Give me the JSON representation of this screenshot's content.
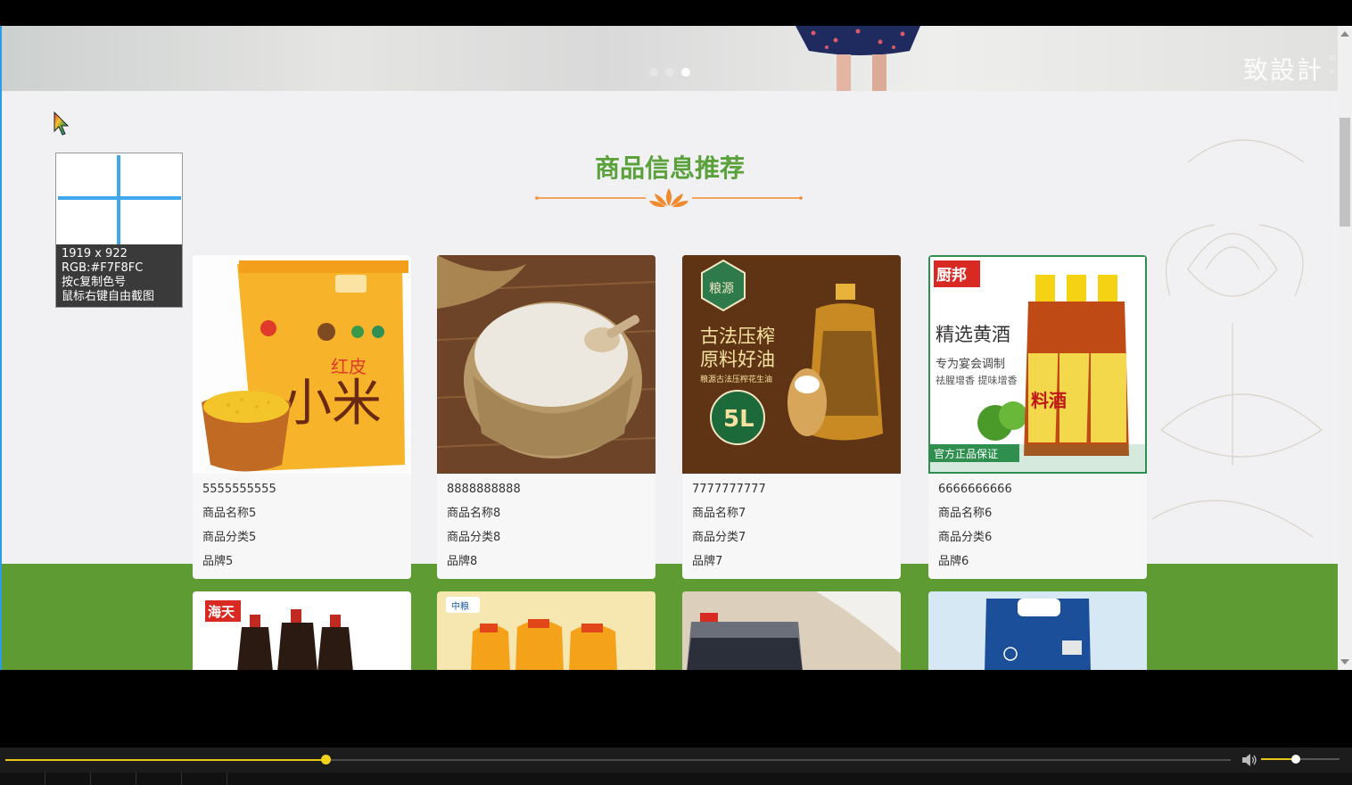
{
  "section": {
    "title": "商品信息推荐"
  },
  "banner": {
    "watermark": "致設計",
    "watermark_small": "申\nw",
    "slide_count": 3,
    "active_slide": 3
  },
  "picker": {
    "size": "1919 x 922",
    "color": "RGB:#F7F8FC",
    "hint1": "按c复制色号",
    "hint2": "鼠标右键自由截图"
  },
  "products": [
    {
      "code": "5555555555",
      "name": "商品名称5",
      "category": "商品分类5",
      "brand": "品牌5",
      "image": {
        "brand_text": "红皮",
        "main_text": "小米"
      }
    },
    {
      "code": "8888888888",
      "name": "商品名称8",
      "category": "商品分类8",
      "brand": "品牌8",
      "image": {}
    },
    {
      "code": "7777777777",
      "name": "商品名称7",
      "category": "商品分类7",
      "brand": "品牌7",
      "image": {
        "logo": "粮源",
        "headline1": "古法压榨",
        "headline2": "原料好油",
        "sub": "粮源古法压榨花生油",
        "badge": "5L"
      }
    },
    {
      "code": "6666666666",
      "name": "商品名称6",
      "category": "商品分类6",
      "brand": "品牌6",
      "image": {
        "logo": "厨邦",
        "headline": "精选黄酒",
        "sub1": "专为宴会调制",
        "sub2": "祛腥增香 提味增香",
        "label": "料酒",
        "badge": "官方正品保证"
      }
    }
  ],
  "products_row2": [
    {
      "image": {
        "logo": "海天"
      }
    },
    {
      "image": {
        "logo": "中粮"
      }
    },
    {
      "image": {}
    },
    {
      "image": {}
    }
  ],
  "player": {
    "progress": 0.261,
    "volume": 0.44
  },
  "colors": {
    "accent_green": "#5aa13c",
    "band_green": "#5f9b33",
    "ornament_orange": "#f08a2d",
    "picker_blue": "#3fa7ec"
  },
  "icons": [
    "cursor-icon",
    "lotus-icon",
    "volume-icon"
  ]
}
